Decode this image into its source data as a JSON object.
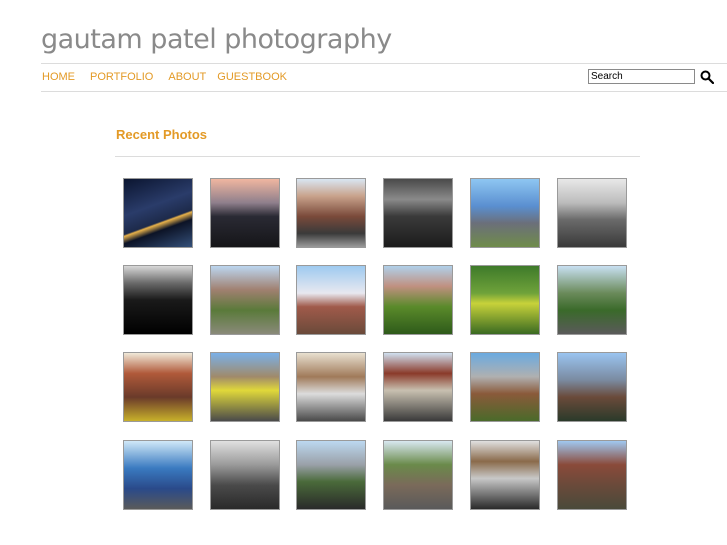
{
  "header": {
    "site_title": "gautam patel photography"
  },
  "nav": {
    "items": [
      {
        "label": "HOME"
      },
      {
        "label": "PORTFOLIO"
      },
      {
        "label": "ABOUT"
      },
      {
        "label": "GUESTBOOK"
      }
    ]
  },
  "search": {
    "value": "Search"
  },
  "main": {
    "section_title": "Recent Photos",
    "photos": [
      {
        "tone": "linear-gradient(160deg,#0b1530 0%,#2a3c6a 40%,#1d2a4a 60%,#e8b24a 62%,#0c1326 70%,#34507a 100%)"
      },
      {
        "tone": "linear-gradient(180deg,#f0b6a0 0%,#8f7f8c 35%,#2a2a34 55%,#151518 100%)"
      },
      {
        "tone": "linear-gradient(180deg,#d9e6f2 0%,#c9a38c 25%,#7a4a3a 55%,#3a3a3a 80%,#9a9a9a 100%)"
      },
      {
        "tone": "linear-gradient(180deg,#4a4a4a 0%,#8a8a8a 30%,#3a3a3a 55%,#1c1c1c 100%)"
      },
      {
        "tone": "linear-gradient(180deg,#8ec6f2 0%,#5a8fd0 40%,#6b6f7a 65%,#6f8c4a 100%)"
      },
      {
        "tone": "linear-gradient(180deg,#e8e8e8 0%,#bcbcbc 35%,#6a6a6a 60%,#3a3a3a 100%)"
      },
      {
        "tone": "linear-gradient(180deg,#d8d8d8 0%,#6a6a6a 25%,#1a1a1a 50%,#000000 100%)"
      },
      {
        "tone": "linear-gradient(180deg,#bcd6f0 0%,#a08070 35%,#5a7a3a 65%,#8a8a7a 100%)"
      },
      {
        "tone": "linear-gradient(180deg,#9ecaf0 0%,#e8e8f0 40%,#a05a4a 60%,#6a4a3a 100%)"
      },
      {
        "tone": "linear-gradient(180deg,#b0d0ea 0%,#c09080 30%,#5a8a2a 60%,#2e5a1a 100%)"
      },
      {
        "tone": "linear-gradient(180deg,#3e7a2a 0%,#6fa23a 40%,#c8d23a 55%,#3a6a22 100%)"
      },
      {
        "tone": "linear-gradient(180deg,#c8e0f2 0%,#6a8a5a 40%,#3a6a2a 65%,#5a5a5a 100%)"
      },
      {
        "tone": "linear-gradient(180deg,#f0e8d8 0%,#b05a3a 30%,#6a3a2a 65%,#c8b02a 100%)"
      },
      {
        "tone": "linear-gradient(180deg,#7ab0e8 0%,#a08a6a 35%,#e0d83a 55%,#4a4a4a 100%)"
      },
      {
        "tone": "linear-gradient(180deg,#e8e0d0 0%,#a07a5a 35%,#dcdcdc 60%,#4a4a4a 100%)"
      },
      {
        "tone": "linear-gradient(180deg,#d0e0f0 0%,#8a3a2a 30%,#c8c0b0 55%,#3a3a3a 100%)"
      },
      {
        "tone": "linear-gradient(180deg,#6aaae0 0%,#b0b0b0 35%,#8a5a3a 60%,#4a6a2a 100%)"
      },
      {
        "tone": "linear-gradient(180deg,#9ac4f0 0%,#7a8aa0 40%,#6a4a3a 65%,#2a3a2a 100%)"
      },
      {
        "tone": "linear-gradient(180deg,#d0e8f8 0%,#3a7ac0 40%,#2a4a8a 70%,#5a5a5a 100%)"
      },
      {
        "tone": "linear-gradient(180deg,#e0e0e0 0%,#9a9a9a 35%,#4a4a4a 65%,#2a2a2a 100%)"
      },
      {
        "tone": "linear-gradient(180deg,#bcd8f0 0%,#9aa0a8 35%,#4a6a3a 60%,#2a2a2a 100%)"
      },
      {
        "tone": "linear-gradient(180deg,#d8e8f0 0%,#6a8a4a 35%,#7a6a5a 65%,#5a5a5a 100%)"
      },
      {
        "tone": "linear-gradient(180deg,#e0e0e0 0%,#8a6a4a 30%,#c8c8c8 55%,#2a2a2a 100%)"
      },
      {
        "tone": "linear-gradient(180deg,#a0c8f0 0%,#8a4a3a 35%,#6a4a3a 65%,#4a4a3a 100%)"
      }
    ]
  }
}
